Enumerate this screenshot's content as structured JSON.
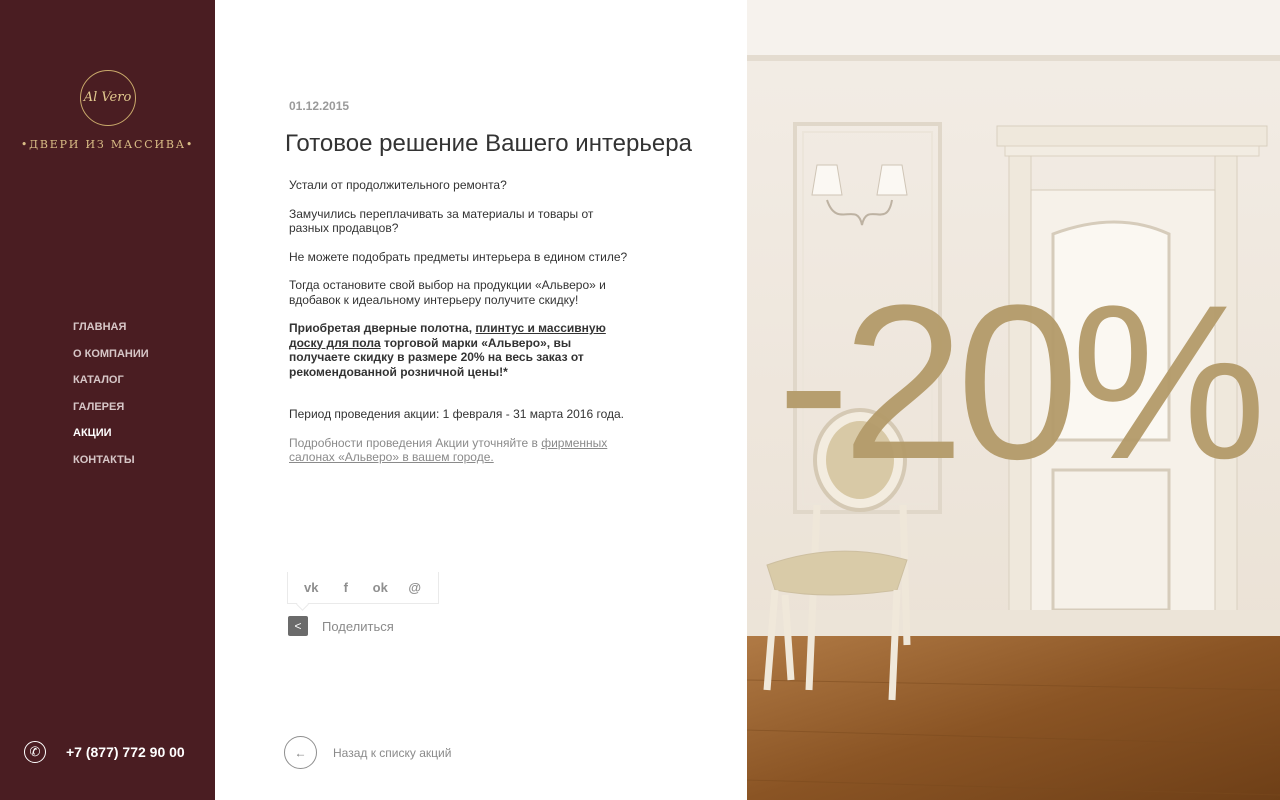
{
  "brand": {
    "logo_text": "Al Vero",
    "tagline": "•ДВЕРИ ИЗ МАССИВА•"
  },
  "nav": {
    "items": [
      {
        "label": "ГЛАВНАЯ"
      },
      {
        "label": "О КОМПАНИИ"
      },
      {
        "label": "КАТАЛОГ"
      },
      {
        "label": "ГАЛЕРЕЯ"
      },
      {
        "label": "АКЦИИ",
        "active": true
      },
      {
        "label": "КОНТАКТЫ"
      }
    ]
  },
  "contact": {
    "phone": "+7 (877) 772 90 00",
    "icon": "phone-icon"
  },
  "article": {
    "date": "01.12.2015",
    "title": "Готовое решение Вашего интерьера",
    "p1": "Устали от продолжительного ремонта?",
    "p2": "Замучились переплачивать за материалы и товары от разных продавцов?",
    "p3": "Не можете подобрать предметы интерьера в едином стиле?",
    "p4": "Тогда остановите свой выбор на продукции «Альверо» и вдобавок к идеальному интерьеру получите скидку!",
    "lead_a": "Приобретая дверные полотна, ",
    "lead_b": "плинтус и массивную доску для пола",
    "lead_c": " торговой марки «Альверо», вы получаете скидку в размере 20% на весь заказ от рекомендованной розничной цены!*",
    "period": "Период проведения акции: 1 февраля - 31 марта 2016 года.",
    "note_a": "Подробности проведения Акции уточняйте в ",
    "note_link": "фирменных салонах «Альверо» в вашем городе."
  },
  "share": {
    "networks": [
      {
        "icon": "vk-icon",
        "glyph": "vk"
      },
      {
        "icon": "facebook-icon",
        "glyph": "f"
      },
      {
        "icon": "odnoklassniki-icon",
        "glyph": "ok"
      },
      {
        "icon": "email-icon",
        "glyph": "@"
      }
    ],
    "label": "Поделиться"
  },
  "back": {
    "label": "Назад к списку акций"
  },
  "promo": {
    "discount": "-20%",
    "accent_color": "#b49b6a"
  },
  "colors": {
    "sidebar_bg": "#4a1d22",
    "gold": "#c9a96b"
  }
}
